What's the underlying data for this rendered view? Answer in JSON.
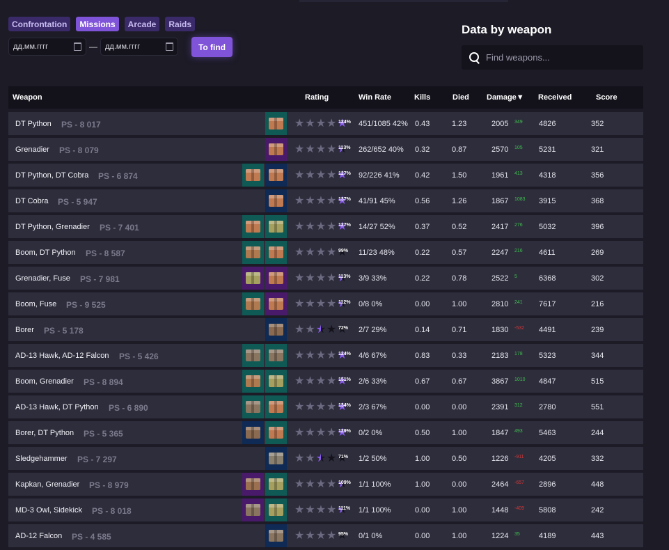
{
  "tabs": [
    {
      "label": "Confrontation",
      "active": false
    },
    {
      "label": "Missions",
      "active": true
    },
    {
      "label": "Arcade",
      "active": false
    },
    {
      "label": "Raids",
      "active": false
    }
  ],
  "filters": {
    "date_from_placeholder": "дд.мм.гггг",
    "date_to_placeholder": "дд.мм.гггг",
    "separator": "—",
    "find_label": "To find"
  },
  "weapon_panel": {
    "title": "Data by weapon",
    "search_placeholder": "Find weapons..."
  },
  "table": {
    "headers": {
      "weapon": "Weapon",
      "rating": "Rating",
      "win_rate": "Win Rate",
      "kills": "Kills",
      "died": "Died",
      "damage": "Damage▼",
      "received": "Received",
      "score": "Score"
    },
    "colors": {
      "row_bg": "#2e2d3c",
      "star_on": "#8a5cf0",
      "star_dim": "#6c6a80",
      "star_off": "#14131c",
      "positive": "#3fbf4f",
      "negative": "#d03838"
    },
    "rows": [
      {
        "weapon": "DT Python",
        "ps": "PS - 8 017",
        "thumbs": [
          "teal-crate"
        ],
        "stars": "full5",
        "pct": "124%",
        "win": "451/1085 42%",
        "kills": "0.43",
        "died": "1.23",
        "damage": "2005",
        "delta": "349",
        "delta_sign": "pos",
        "received": "4826",
        "score": "352"
      },
      {
        "weapon": "Grenadier",
        "ps": "PS - 8 079",
        "thumbs": [
          "purple-crate"
        ],
        "stars": "four-half",
        "pct": "113%",
        "win": "262/652 40%",
        "kills": "0.32",
        "died": "0.87",
        "damage": "2570",
        "delta": "105",
        "delta_sign": "pos",
        "received": "5231",
        "score": "321"
      },
      {
        "weapon": "DT Python, DT Cobra",
        "ps": "PS - 6 874",
        "thumbs": [
          "teal-crate",
          "blue-crate"
        ],
        "stars": "full5",
        "pct": "127%",
        "win": "92/226 41%",
        "kills": "0.42",
        "died": "1.50",
        "damage": "1961",
        "delta": "413",
        "delta_sign": "pos",
        "received": "4318",
        "score": "356"
      },
      {
        "weapon": "DT Cobra",
        "ps": "PS - 5 947",
        "thumbs": [
          "blue-crate"
        ],
        "stars": "full5",
        "pct": "137%",
        "win": "41/91 45%",
        "kills": "0.56",
        "died": "1.26",
        "damage": "1867",
        "delta": "1083",
        "delta_sign": "pos",
        "received": "3915",
        "score": "368"
      },
      {
        "weapon": "DT Python, Grenadier",
        "ps": "PS - 7 401",
        "thumbs": [
          "teal-crate",
          "teal-crate-olive"
        ],
        "stars": "full5",
        "pct": "127%",
        "win": "14/27 52%",
        "kills": "0.37",
        "died": "0.52",
        "damage": "2417",
        "delta": "276",
        "delta_sign": "pos",
        "received": "5032",
        "score": "396"
      },
      {
        "weapon": "Boom, DT Python",
        "ps": "PS - 8 587",
        "thumbs": [
          "teal-gun",
          "teal-crate"
        ],
        "stars": "four",
        "pct": "99%",
        "win": "11/23 48%",
        "kills": "0.22",
        "died": "0.57",
        "damage": "2247",
        "delta": "216",
        "delta_sign": "pos",
        "received": "4611",
        "score": "269"
      },
      {
        "weapon": "Grenadier, Fuse",
        "ps": "PS - 7 981",
        "thumbs": [
          "purple-crate-olive",
          "purple-crate"
        ],
        "stars": "four-half",
        "pct": "113%",
        "win": "3/9 33%",
        "kills": "0.22",
        "died": "0.78",
        "damage": "2522",
        "delta": "5",
        "delta_sign": "pos",
        "received": "6368",
        "score": "302"
      },
      {
        "weapon": "Boom, Fuse",
        "ps": "PS - 9 525",
        "thumbs": [
          "teal-gun",
          "purple-crate"
        ],
        "stars": "four-half",
        "pct": "112%",
        "win": "0/8 0%",
        "kills": "0.00",
        "died": "1.00",
        "damage": "2810",
        "delta": "241",
        "delta_sign": "pos",
        "received": "7617",
        "score": "216"
      },
      {
        "weapon": "Borer",
        "ps": "PS - 5 178",
        "thumbs": [
          "blue-drill"
        ],
        "stars": "two-half",
        "pct": "72%",
        "win": "2/7 29%",
        "kills": "0.14",
        "died": "0.71",
        "damage": "1830",
        "delta": "-532",
        "delta_sign": "neg",
        "received": "4491",
        "score": "239"
      },
      {
        "weapon": "AD-13 Hawk, AD-12 Falcon",
        "ps": "PS - 5 426",
        "thumbs": [
          "teal-tower",
          "teal-tower"
        ],
        "stars": "full5",
        "pct": "124%",
        "win": "4/6 67%",
        "kills": "0.83",
        "died": "0.33",
        "damage": "2183",
        "delta": "178",
        "delta_sign": "pos",
        "received": "5323",
        "score": "344"
      },
      {
        "weapon": "Boom, Grenadier",
        "ps": "PS - 8 894",
        "thumbs": [
          "teal-gun",
          "teal-crate-olive"
        ],
        "stars": "full5",
        "pct": "151%",
        "win": "2/6 33%",
        "kills": "0.67",
        "died": "0.67",
        "damage": "3867",
        "delta": "1010",
        "delta_sign": "pos",
        "received": "4847",
        "score": "515"
      },
      {
        "weapon": "AD-13 Hawk, DT Python",
        "ps": "PS - 6 890",
        "thumbs": [
          "teal-tower",
          "teal-crate"
        ],
        "stars": "full5",
        "pct": "134%",
        "win": "2/3 67%",
        "kills": "0.00",
        "died": "0.00",
        "damage": "2391",
        "delta": "312",
        "delta_sign": "pos",
        "received": "2780",
        "score": "551"
      },
      {
        "weapon": "Borer, DT Python",
        "ps": "PS - 5 365",
        "thumbs": [
          "blue-drill",
          "teal-crate"
        ],
        "stars": "full5",
        "pct": "129%",
        "win": "0/2 0%",
        "kills": "0.50",
        "died": "1.00",
        "damage": "1847",
        "delta": "493",
        "delta_sign": "pos",
        "received": "5463",
        "score": "244"
      },
      {
        "weapon": "Sledgehammer",
        "ps": "PS - 7 297",
        "thumbs": [
          "blue-cannon"
        ],
        "stars": "two-half",
        "pct": "71%",
        "win": "1/2 50%",
        "kills": "1.00",
        "died": "0.50",
        "damage": "1226",
        "delta": "-911",
        "delta_sign": "neg",
        "received": "4205",
        "score": "332"
      },
      {
        "weapon": "Kapkan, Grenadier",
        "ps": "PS - 8 979",
        "thumbs": [
          "purple-trap",
          "teal-crate-olive"
        ],
        "stars": "four-half",
        "pct": "109%",
        "win": "1/1 100%",
        "kills": "1.00",
        "died": "0.00",
        "damage": "2464",
        "delta": "-657",
        "delta_sign": "neg",
        "received": "2896",
        "score": "448"
      },
      {
        "weapon": "MD-3 Owl, Sidekick",
        "ps": "PS - 8 018",
        "thumbs": [
          "purple-tower",
          "teal-crate-olive"
        ],
        "stars": "four-half",
        "pct": "111%",
        "win": "1/1 100%",
        "kills": "0.00",
        "died": "1.00",
        "damage": "1448",
        "delta": "-409",
        "delta_sign": "neg",
        "received": "5808",
        "score": "242"
      },
      {
        "weapon": "AD-12 Falcon",
        "ps": "PS - 4 585",
        "thumbs": [
          "blue-tower"
        ],
        "stars": "four",
        "pct": "95%",
        "win": "0/1 0%",
        "kills": "0.00",
        "died": "1.00",
        "damage": "1224",
        "delta": "35",
        "delta_sign": "pos",
        "received": "4189",
        "score": "443"
      }
    ]
  }
}
